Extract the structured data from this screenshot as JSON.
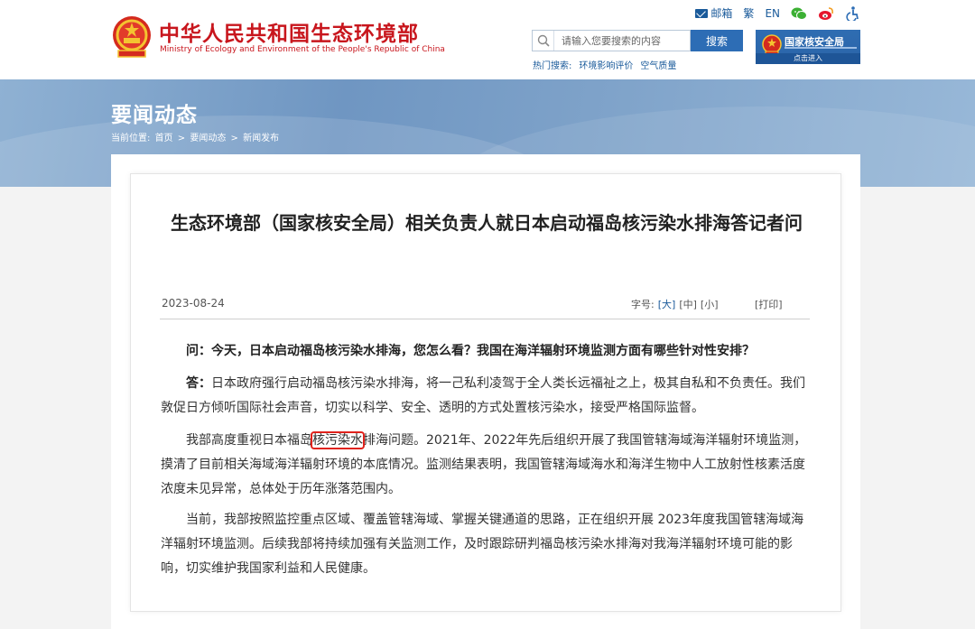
{
  "header": {
    "title_cn": "中华人民共和国生态环境部",
    "title_en": "Ministry of Ecology and Environment of the People's Republic of China",
    "links": {
      "mail": "邮箱",
      "traditional": "繁",
      "english": "EN"
    },
    "search": {
      "placeholder": "请输入您要搜索的内容",
      "button": "搜索"
    },
    "hot_search": {
      "label": "热门搜索:",
      "items": [
        "环境影响评价",
        "空气质量"
      ]
    },
    "nsa_banner": {
      "title": "国家核安全局",
      "enter": "点击进入"
    }
  },
  "band": {
    "section_title": "要闻动态",
    "breadcrumb": {
      "label": "当前位置:",
      "items": [
        "首页",
        ">",
        "要闻动态",
        ">",
        "新闻发布"
      ]
    }
  },
  "article": {
    "title": "生态环境部（国家核安全局）相关负责人就日本启动福岛核污染水排海答记者问",
    "date": "2023-08-24",
    "font_size": {
      "label": "字号:",
      "large": "[大]",
      "medium": "[中]",
      "small": "[小]"
    },
    "print": "[打印]",
    "question": "问：今天，日本启动福岛核污染水排海，您怎么看？我国在海洋辐射环境监测方面有哪些针对性安排？",
    "answer_lead": "答：",
    "answer_text": "日本政府强行启动福岛核污染水排海，将一己私利凌驾于全人类长远福祉之上，极其自私和不负责任。我们敦促日方倾听国际社会声音，切实以科学、安全、透明的方式处置核污染水，接受严格国际监督。",
    "para2_before": "我部高度重视日本福岛",
    "para2_highlight": "核污染水",
    "para2_after": "排海问题。2021年、2022年先后组织开展了我国管辖海域海洋辐射环境监测，摸清了目前相关海域海洋辐射环境的本底情况。监测结果表明，我国管辖海域海水和海洋生物中人工放射性核素活度浓度未见异常，总体处于历年涨落范围内。",
    "para3": "当前，我部按照监控重点区域、覆盖管辖海域、掌握关键通道的思路，正在组织开展 2023年度我国管辖海域海洋辐射环境监测。后续我部将持续加强有关监测工作，及时跟踪研判福岛核污染水排海对我海洋辐射环境可能的影响，切实维护我国家利益和人民健康。"
  },
  "colors": {
    "brand_red": "#c8161d",
    "link_blue": "#1a5a9a",
    "button_blue": "#2d6db5",
    "highlight_red": "#e0221c"
  },
  "icons": [
    "national-emblem-icon",
    "mail-icon",
    "wechat-icon",
    "weibo-icon",
    "accessibility-icon",
    "search-icon"
  ]
}
